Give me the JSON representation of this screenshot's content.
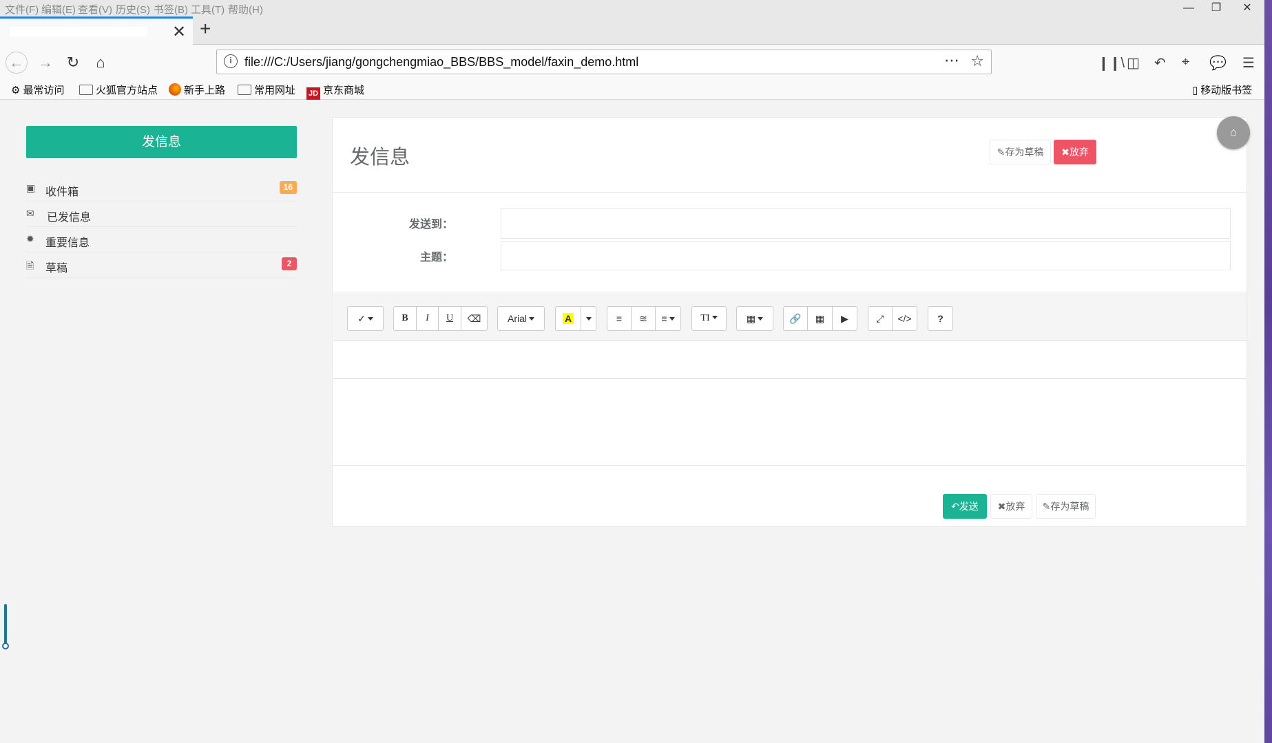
{
  "browser": {
    "menu": [
      "文件(F)",
      "编辑(E)",
      "查看(V)",
      "历史(S)",
      "书签(B)",
      "工具(T)",
      "帮助(H)"
    ],
    "tab_close": "✕",
    "new_tab": "+",
    "url": "file:///C:/Users/jiang/gongchengmiao_BBS/BBS_model/faxin_demo.html",
    "bookmarks": [
      "最常访问",
      "火狐官方站点",
      "新手上路",
      "常用网址",
      "京东商城"
    ],
    "mobile_bookmarks": "移动版书签",
    "jd_logo": "JD"
  },
  "sidebar": {
    "compose_label": "发信息",
    "folders": [
      {
        "label": "收件箱",
        "icon": "inbox-icon",
        "badge": "16",
        "badge_color": "#f8ac59"
      },
      {
        "label": "已发信息",
        "icon": "envelope-icon",
        "badge": "",
        "badge_color": ""
      },
      {
        "label": "重要信息",
        "icon": "certificate-icon",
        "badge": "",
        "badge_color": ""
      },
      {
        "label": "草稿",
        "icon": "file-icon",
        "badge": "2",
        "badge_color": "#ed5565"
      }
    ]
  },
  "mail": {
    "title": "发信息",
    "save_draft_label": "存为草稿",
    "discard_label": "放弃",
    "to_label": "发送到：",
    "to_value": "",
    "subject_label": "主题：",
    "subject_value": ""
  },
  "toolbar": {
    "font_name": "Arial",
    "bold": "B",
    "italic": "I",
    "underline": "U",
    "help": "?",
    "font_size_glyph": "TI",
    "highlight_glyph": "A"
  },
  "footer": {
    "send_label": "发送",
    "discard_label": "放弃",
    "save_draft_label": "存为草稿"
  },
  "colors": {
    "primary": "#1ab394",
    "danger": "#ed5565",
    "warning": "#f8ac59"
  }
}
